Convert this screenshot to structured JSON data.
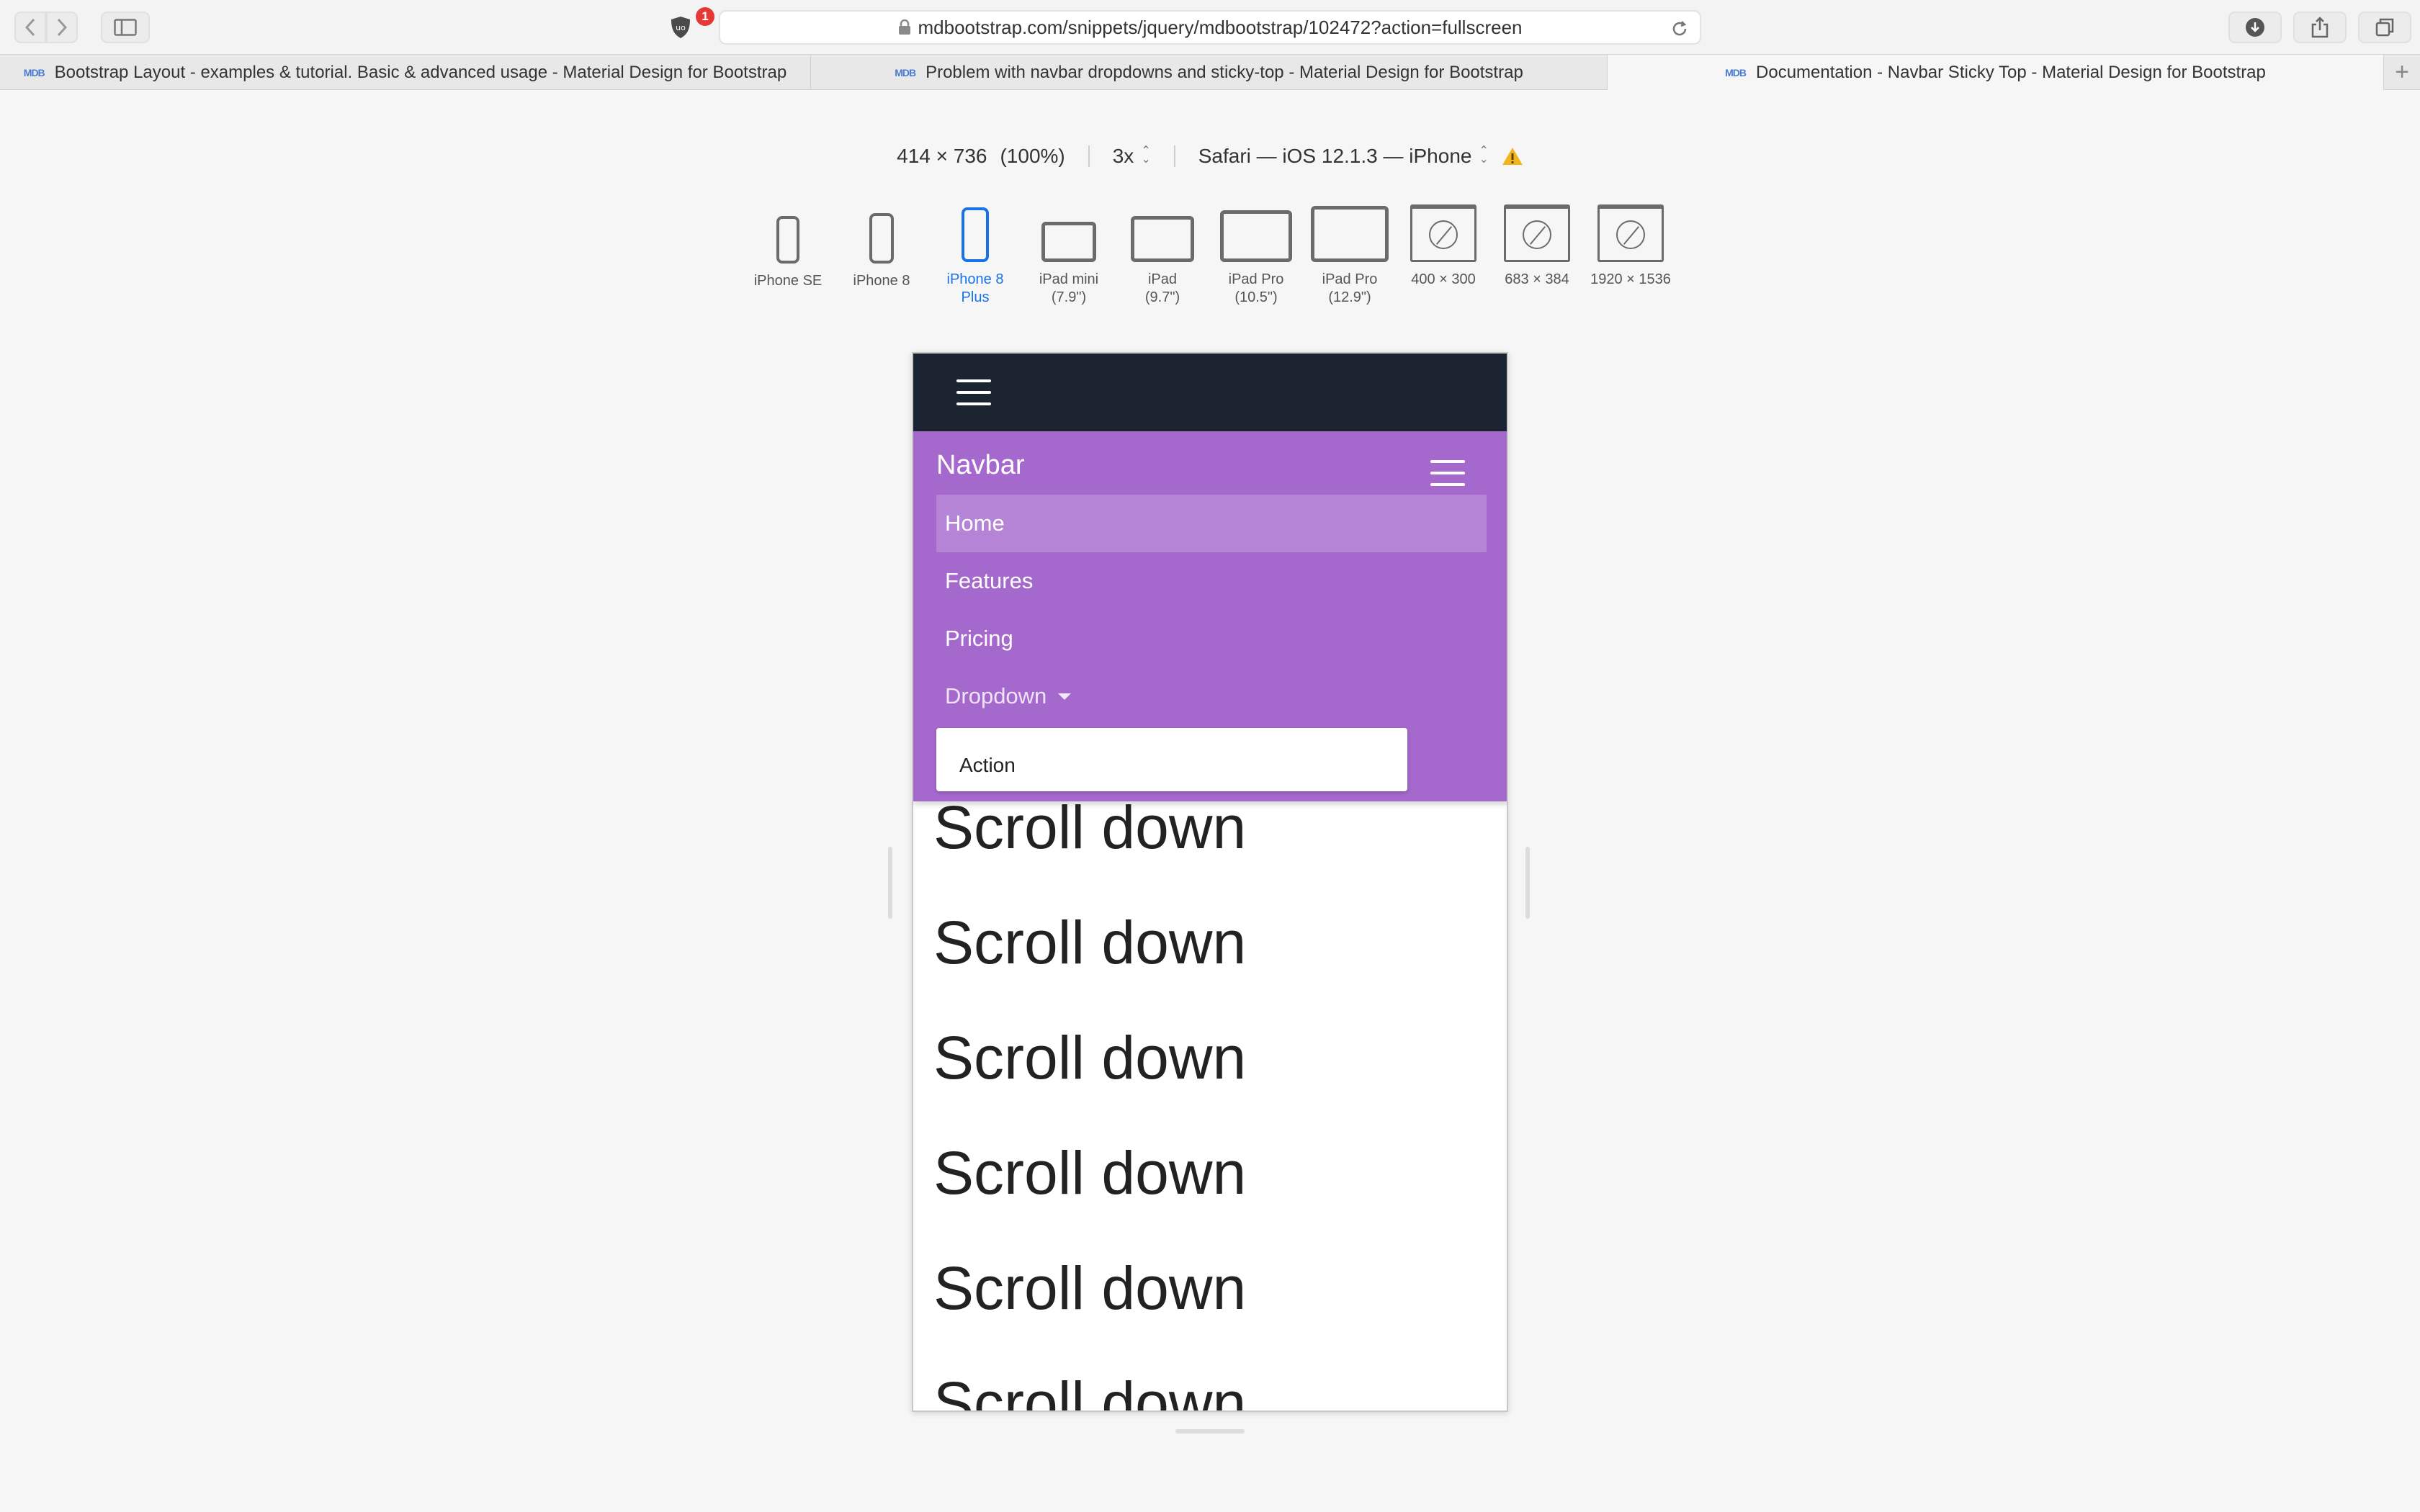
{
  "browser": {
    "url": "mdbootstrap.com/snippets/jquery/mdbootstrap/102472?action=fullscreen",
    "extension_badge": "1",
    "tabs": [
      {
        "logo": "MDB",
        "title": "Bootstrap Layout - examples & tutorial. Basic & advanced usage - Material Design for Bootstrap",
        "active": false
      },
      {
        "logo": "MDB",
        "title": "Problem with navbar dropdowns and sticky-top - Material Design for Bootstrap",
        "active": false
      },
      {
        "logo": "MDB",
        "title": "Documentation - Navbar Sticky Top - Material Design for Bootstrap",
        "active": true
      }
    ]
  },
  "responsive_mode": {
    "dimensions": "414 × 736",
    "zoom": "(100%)",
    "scale": "3x",
    "user_agent": "Safari — iOS 12.1.3 — iPhone",
    "devices": [
      {
        "line1": "iPhone SE",
        "line2": ""
      },
      {
        "line1": "iPhone 8",
        "line2": ""
      },
      {
        "line1": "iPhone 8",
        "line2": "Plus",
        "selected": true
      },
      {
        "line1": "iPad mini",
        "line2": "(7.9\")"
      },
      {
        "line1": "iPad",
        "line2": "(9.7\")"
      },
      {
        "line1": "iPad Pro",
        "line2": "(10.5\")"
      },
      {
        "line1": "iPad Pro",
        "line2": "(12.9\")"
      },
      {
        "line1": "400 × 300",
        "line2": ""
      },
      {
        "line1": "683 × 384",
        "line2": ""
      },
      {
        "line1": "1920 × 1536",
        "line2": ""
      }
    ]
  },
  "page": {
    "navbar_brand": "Navbar",
    "nav_items": [
      "Home",
      "Features",
      "Pricing",
      "Dropdown"
    ],
    "dropdown_items": [
      "Action"
    ],
    "content_lines": [
      "Scroll down",
      "Scroll down",
      "Scroll down",
      "Scroll down",
      "Scroll down",
      "Scroll down"
    ]
  },
  "colors": {
    "dark_navbar": "#1c2331",
    "purple_navbar": "#a569cd",
    "selected_device": "#1873e8"
  }
}
